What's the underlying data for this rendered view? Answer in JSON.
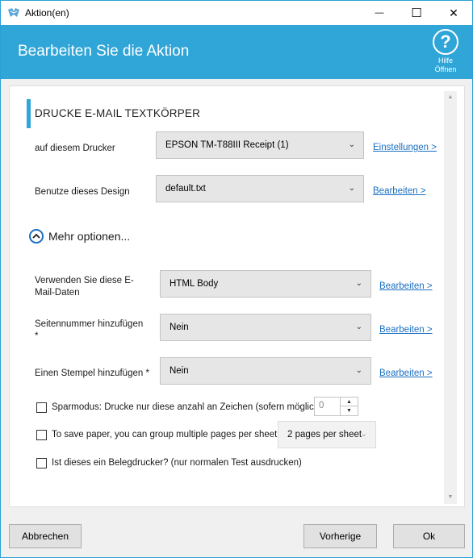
{
  "window": {
    "title": "Aktion(en)",
    "minimize_glyph": "—",
    "maximize_glyph": "☐",
    "close_glyph": "✕"
  },
  "header": {
    "title": "Bearbeiten Sie die Aktion",
    "help_glyph": "?",
    "help_label_1": "Hilfe",
    "help_label_2": "Öffnen",
    "color": "#2fa5d8"
  },
  "section": {
    "title": "DRUCKE E-MAIL TEXTKÖRPER"
  },
  "printer": {
    "label": "auf diesem Drucker",
    "value": "EPSON TM-T88III Receipt (1)",
    "link": "Einstellungen >"
  },
  "design": {
    "label": "Benutze dieses Design",
    "value": "default.txt",
    "link": "Bearbeiten >"
  },
  "more_options": {
    "label": "Mehr optionen...",
    "icon": "chevron-up-icon"
  },
  "email_data": {
    "label_line1": "Verwenden Sie diese E-",
    "label_line2": "Mail-Daten",
    "value": "HTML Body",
    "link": "Bearbeiten >"
  },
  "page_number": {
    "label_line1": "Seitennummer hinzufügen",
    "label_line2": "*",
    "value": "Nein",
    "link": "Bearbeiten >"
  },
  "stamp": {
    "label": "Einen Stempel hinzufügen *",
    "value": "Nein",
    "link": "Bearbeiten >"
  },
  "saving_mode": {
    "label": "Sparmodus: Drucke nur diese anzahl an Zeichen (sofern möglich):",
    "checked": false,
    "value": "0"
  },
  "group_pages": {
    "label": "To save paper, you can group multiple pages per sheet",
    "checked": false,
    "value": "2 pages per sheet"
  },
  "receipt_printer": {
    "label": "Ist dieses ein Belegdrucker? (nur normalen Test ausdrucken)",
    "checked": false
  },
  "footer": {
    "cancel": "Abbrechen",
    "previous": "Vorherige",
    "ok": "Ok"
  },
  "link_color": "#1a6fc2"
}
